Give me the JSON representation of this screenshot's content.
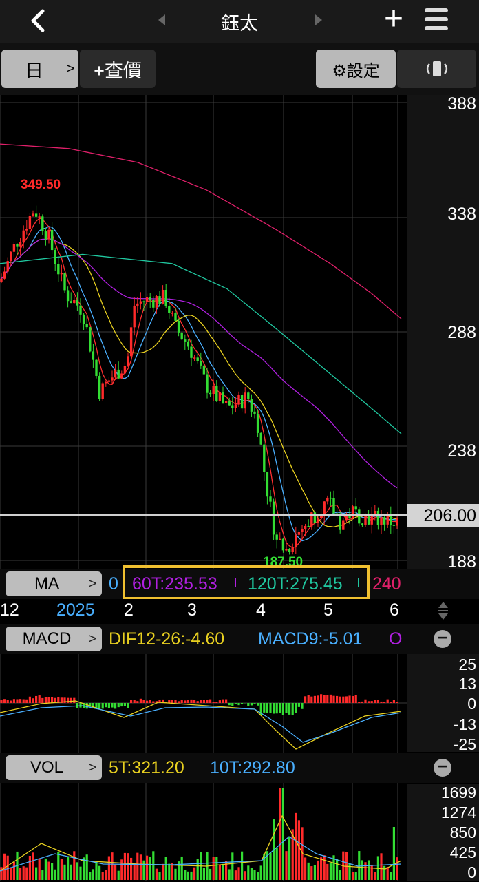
{
  "header": {
    "title": "鈺太",
    "back_icon": "chevron-left-icon",
    "prev_icon": "triangle-left-icon",
    "next_icon": "triangle-right-icon",
    "add_label": "+",
    "menu_icon": "hamburger-icon"
  },
  "toolbar": {
    "period_label": "日",
    "period_arrow": ">",
    "quote_label": "+查價",
    "settings_label": "⚙設定",
    "rotate_icon": "rotate-screen-icon"
  },
  "price_axis": [
    "388",
    "338",
    "288",
    "238",
    "188"
  ],
  "current_price": "206.00",
  "annotations": {
    "high": "349.50",
    "low": "187.50"
  },
  "ma_bar": {
    "label": "MA",
    "arrow": ">",
    "partial_left": "0",
    "ma60": "60T:235.53",
    "ma120": "120T:275.45",
    "partial_right": "240"
  },
  "time_axis": [
    "12",
    "2025",
    "2",
    "3",
    "4",
    "5",
    "6"
  ],
  "macd_bar": {
    "label": "MACD",
    "arrow": ">",
    "dif": "DIF12-26:-4.60",
    "macd9": "MACD9:-5.01",
    "osc_partial": "O"
  },
  "macd_axis": [
    "25",
    "13",
    "0",
    "-13",
    "-25"
  ],
  "vol_bar": {
    "label": "VOL",
    "arrow": ">",
    "t5": "5T:321.20",
    "t10": "10T:292.80"
  },
  "vol_axis": [
    "1699",
    "1274",
    "850",
    "425",
    "0"
  ],
  "colors": {
    "up": "#ff2a2a",
    "down": "#33dd33",
    "ma5": "#ff3030",
    "ma10": "#4ab0ff",
    "ma20": "#e8d020",
    "ma60": "#b020e0",
    "ma120": "#20c8a0",
    "ma240": "#e0206a",
    "highlight": "#f0c030"
  }
}
